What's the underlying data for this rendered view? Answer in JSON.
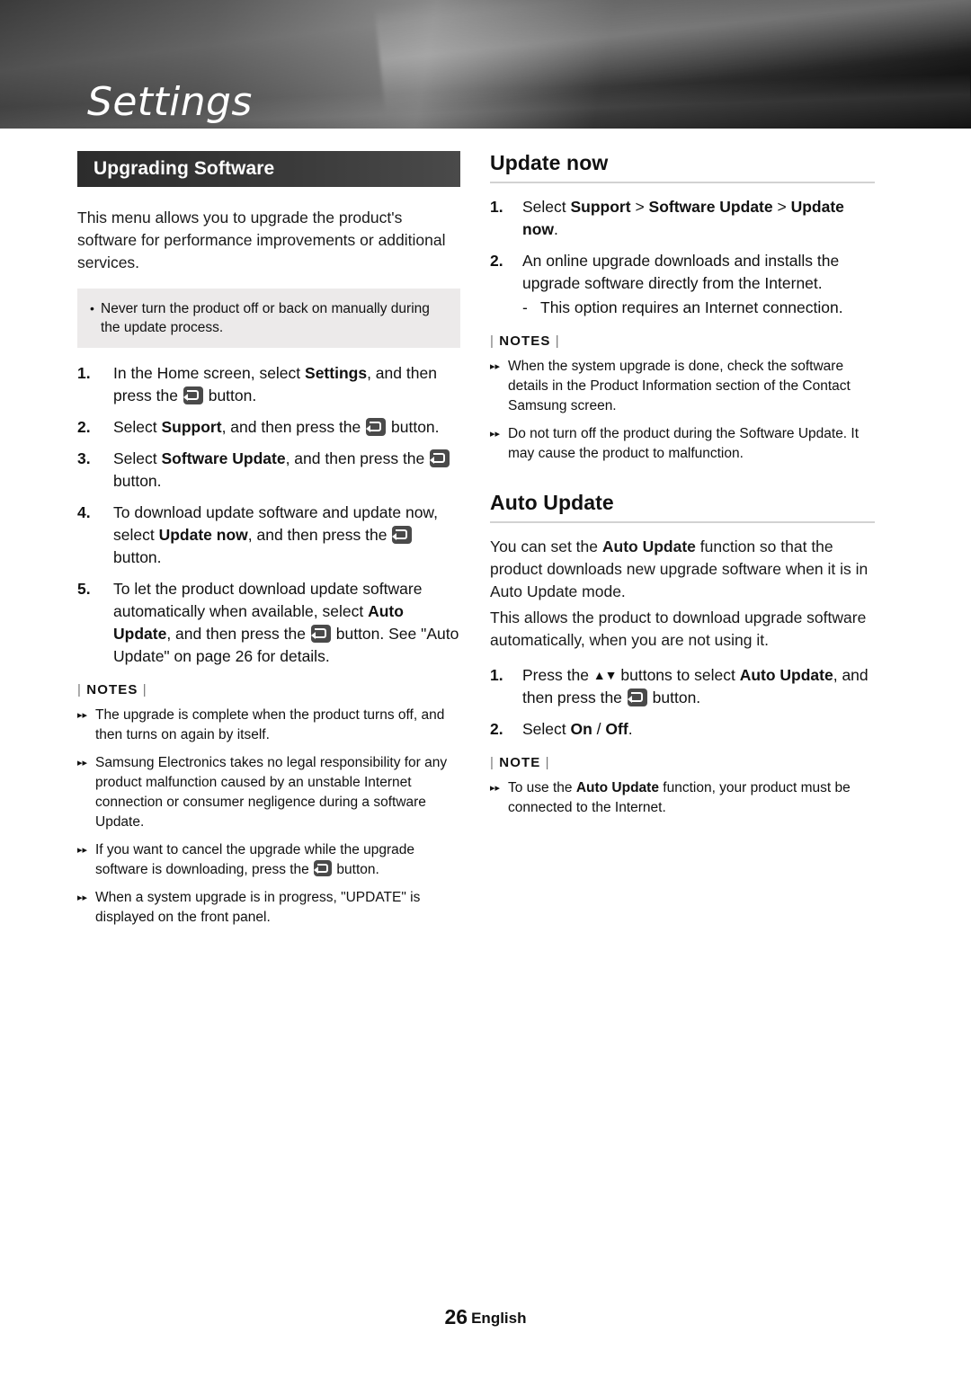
{
  "header": {
    "title": "Settings"
  },
  "left": {
    "section_title": "Upgrading Software",
    "intro": "This menu allows you to upgrade the product's software for performance improvements or additional services.",
    "callout": "Never turn the product off or back on manually during the update process.",
    "steps": [
      {
        "num": "1.",
        "pre": "In the Home screen, select ",
        "bold1": "Settings",
        "mid": ", and then press the ",
        "post": " button."
      },
      {
        "num": "2.",
        "pre": "Select ",
        "bold1": "Support",
        "mid": ", and then press the ",
        "post": " button."
      },
      {
        "num": "3.",
        "pre": "Select ",
        "bold1": "Software Update",
        "mid": ", and then press the ",
        "post": " button."
      },
      {
        "num": "4.",
        "pre": "To download update software and update now, select ",
        "bold1": "Update now",
        "mid": ", and then press the ",
        "post": " button."
      },
      {
        "num": "5.",
        "pre": "To let the product download update software automatically when available, select ",
        "bold1": "Auto Update",
        "mid": ", and then press the ",
        "post": " button. See \"Auto Update\" on page 26 for details."
      }
    ],
    "notes_label": "NOTES",
    "notes": [
      "The upgrade is complete when the product turns off, and then turns on again by itself.",
      "Samsung Electronics takes no legal responsibility for any product malfunction caused by an unstable Internet connection or consumer negligence during a software Update.",
      "If you want to cancel the upgrade while the upgrade software is downloading, press the  button.",
      "When a system upgrade is in progress, \"UPDATE\" is displayed on the front panel."
    ],
    "note3_pre": "If you want to cancel the upgrade while the upgrade software is downloading, press the ",
    "note3_post": " button."
  },
  "right": {
    "heading1": "Update now",
    "step1_num": "1.",
    "step1_pre": "Select ",
    "step1_b1": "Support",
    "step1_sep1": " > ",
    "step1_b2": "Software Update",
    "step1_sep2": " > ",
    "step1_b3": "Update now",
    "step1_end": ".",
    "step2_num": "2.",
    "step2_text": "An online upgrade downloads and installs the upgrade software directly from the Internet.",
    "step2_dash": "-",
    "step2_sub": "This option requires an Internet connection.",
    "notes_label1": "NOTES",
    "notes1": [
      "When the system upgrade is done, check the software details in the Product Information section of the Contact Samsung screen.",
      "Do not turn off the product during the Software Update. It may cause the product to malfunction."
    ],
    "heading2": "Auto Update",
    "para1_pre": "You can set the ",
    "para1_b": "Auto Update",
    "para1_post": " function so that the product downloads new upgrade software when it is in Auto Update mode.",
    "para2": "This allows the product to download upgrade software automatically, when you are not using it.",
    "a_step1_num": "1.",
    "a_step1_pre": "Press the ",
    "a_step1_arrows": "▲▼",
    "a_step1_mid": " buttons to select ",
    "a_step1_b": "Auto Update",
    "a_step1_mid2": ", and then press the ",
    "a_step1_post": " button.",
    "a_step2_num": "2.",
    "a_step2_pre": "Select ",
    "a_step2_b1": "On",
    "a_step2_slash": " / ",
    "a_step2_b2": "Off",
    "a_step2_end": ".",
    "note_label2": "NOTE",
    "note2_pre": "To use the ",
    "note2_b": "Auto Update",
    "note2_post": " function, your product must be connected to the Internet."
  },
  "footer": {
    "page": "26",
    "language": "English"
  }
}
